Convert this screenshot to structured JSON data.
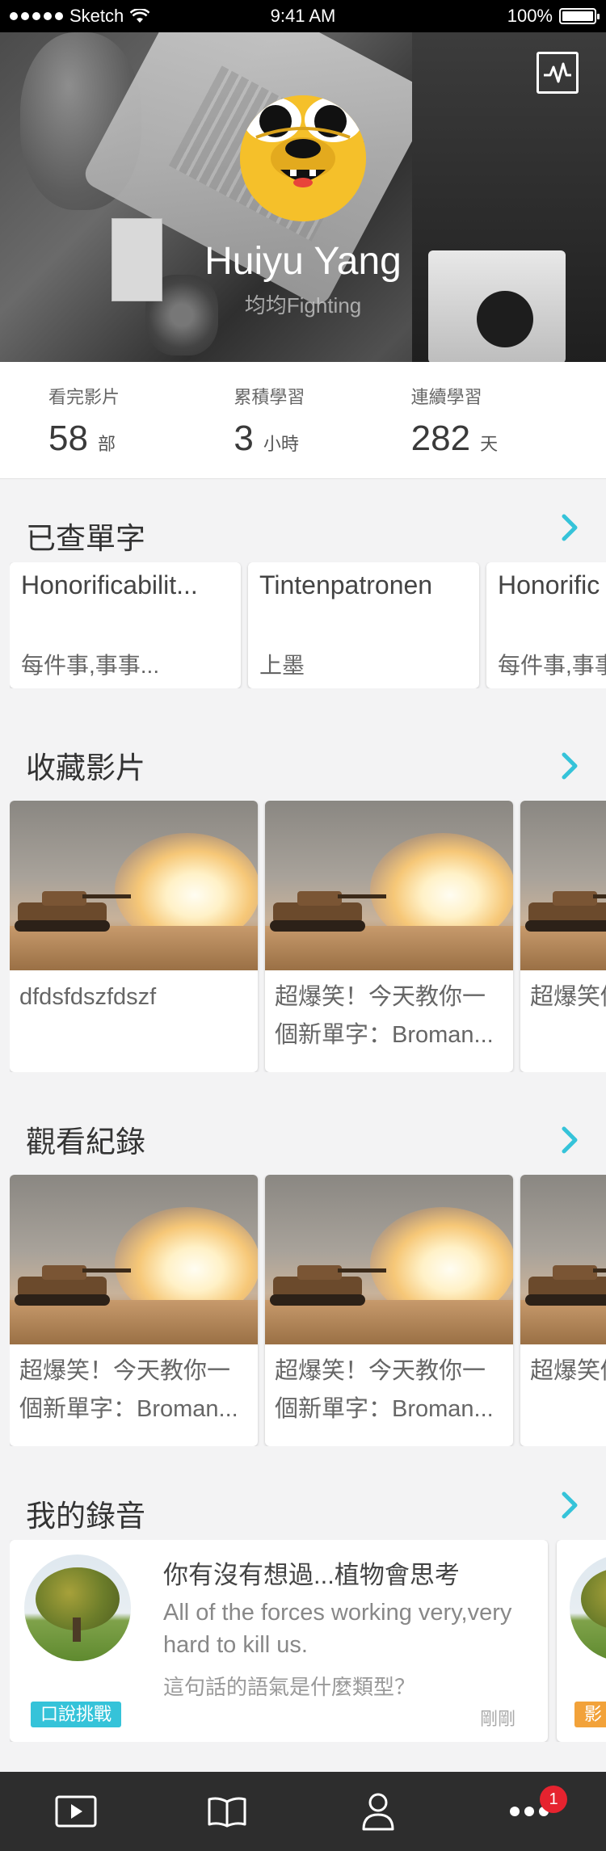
{
  "status_bar": {
    "carrier": "Sketch",
    "time": "9:41 AM",
    "battery": "100%"
  },
  "profile": {
    "name": "Huiyu Yang",
    "subtitle": "均均Fighting"
  },
  "stats": [
    {
      "label": "看完影片",
      "value": "58",
      "unit": "部"
    },
    {
      "label": "累積學習",
      "value": "3",
      "unit": "小時"
    },
    {
      "label": "連續學習",
      "value": "282",
      "unit": "天"
    }
  ],
  "sections": {
    "words": {
      "title": "已查單字",
      "cards": [
        {
          "word": "Honorificabilit...",
          "meaning": "每件事,事事..."
        },
        {
          "word": "Tintenpatronen",
          "meaning": "上墨"
        },
        {
          "word": "Honorific",
          "meaning": "每件事,事事"
        }
      ]
    },
    "favorites": {
      "title": "收藏影片",
      "videos": [
        {
          "caption": "dfdsfdszfdszf"
        },
        {
          "caption": "超爆笑！今天教你一個新單字：Broman..."
        },
        {
          "caption": "超爆笑個新單字"
        }
      ]
    },
    "history": {
      "title": "觀看紀錄",
      "videos": [
        {
          "caption": "超爆笑！今天教你一個新單字：Broman..."
        },
        {
          "caption": "超爆笑！今天教你一個新單字：Broman..."
        },
        {
          "caption": "超爆笑個新單字"
        }
      ]
    },
    "recordings": {
      "title": "我的錄音",
      "items": [
        {
          "title": "你有沒有想過...植物會思考",
          "sentence": "All of the forces working very,very hard to kill us.",
          "question": "這句話的語氣是什麼類型？",
          "tag": "口說挑戰",
          "time": "剛剛",
          "tag_color": "#35c3d9"
        },
        {
          "tag": "影",
          "tag_color": "#f2a23a"
        }
      ]
    }
  },
  "tab_bar": {
    "items": [
      "play-icon",
      "book-icon",
      "user-icon",
      "more-icon"
    ],
    "badge": "1"
  },
  "colors": {
    "accent": "#35c3d9",
    "tab_bar_bg": "#2d2d2d",
    "badge": "#e6232f"
  }
}
